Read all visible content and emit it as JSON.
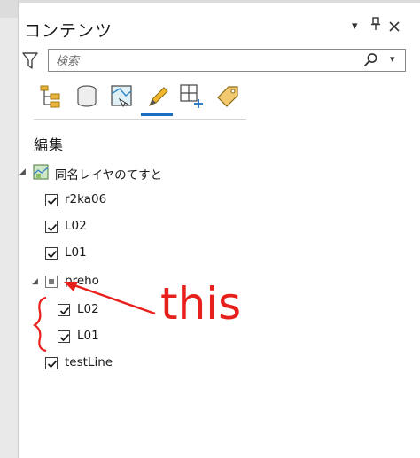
{
  "panel": {
    "title": "コンテンツ",
    "options_icon": "chevron-down-icon",
    "pin_icon": "pin-icon",
    "close_icon": "close-icon"
  },
  "search": {
    "placeholder": "検索",
    "filter_icon": "filter-icon",
    "search_icon": "search-icon",
    "dropdown_icon": "chevron-down-icon"
  },
  "tools": [
    {
      "name": "list-by-drawing-order-icon",
      "selected": false
    },
    {
      "name": "list-by-data-source-icon",
      "selected": false
    },
    {
      "name": "list-by-selection-icon",
      "selected": false
    },
    {
      "name": "list-by-editing-icon",
      "selected": true
    },
    {
      "name": "list-by-snapping-icon",
      "selected": false
    },
    {
      "name": "list-by-labeling-icon",
      "selected": false
    }
  ],
  "section_title": "編集",
  "tree": {
    "group1": {
      "label": "同名レイヤのてすと",
      "expanded": true
    },
    "group1_items": [
      {
        "label": "r2ka06",
        "checked": true
      },
      {
        "label": "L02",
        "checked": true
      },
      {
        "label": "L01",
        "checked": true
      }
    ],
    "group2": {
      "label": "preho",
      "expanded": true,
      "checkbox_state": "indeterminate"
    },
    "group2_items": [
      {
        "label": "L02",
        "checked": true
      },
      {
        "label": "L01",
        "checked": true
      }
    ],
    "top_items": [
      {
        "label": "testLine",
        "checked": true
      }
    ]
  },
  "annotation": {
    "text": "this",
    "color": "#e8201b"
  },
  "colors": {
    "accent": "#1c6ec5",
    "annotation_red": "#e8201b"
  }
}
